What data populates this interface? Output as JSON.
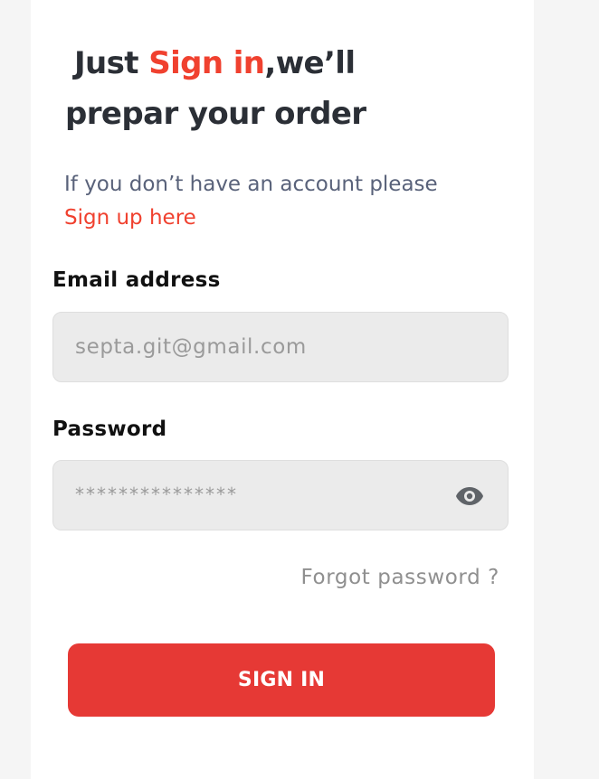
{
  "heading": {
    "line1_prefix": "Just ",
    "line1_accent": "Sign in",
    "line1_suffix": ",we’ll",
    "line2": "prepar your order"
  },
  "subtext": {
    "prefix": "If you don’t have an account please ",
    "link": "Sign up here"
  },
  "email": {
    "label": "Email address",
    "value": "septa.git@gmail.com"
  },
  "password": {
    "label": "Password",
    "value": "***************",
    "toggle_icon": "eye-icon"
  },
  "forgot_password": "Forgot password ?",
  "sign_in_button": "SIGN IN",
  "colors": {
    "accent": "#f0412f",
    "button": "#e63935",
    "heading": "#2b2f36",
    "subtext": "#59627a",
    "field_bg": "#ebebeb"
  }
}
